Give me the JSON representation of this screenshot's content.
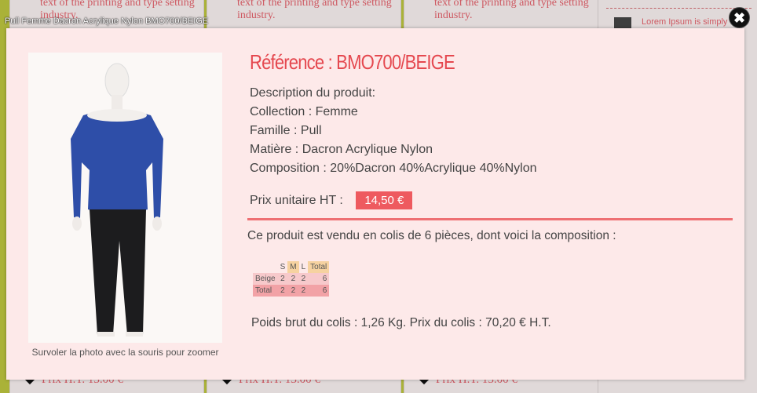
{
  "background": {
    "cards": [
      {
        "text": "text of the printing and type setting industry.",
        "price": "Prix H.T. 13.00 €"
      },
      {
        "text": "text of the printing and type setting industry.",
        "price": "Prix H.T. 13.00 €"
      },
      {
        "text": "text of the printing and type setting industry.",
        "price": "Prix H.T. 13.00 €"
      }
    ],
    "sidebar_text": "Lorem Ipsum is simply"
  },
  "lightbox": {
    "title": "Pull Femme Dacron Acrylique Nylon BMO700/BEIGE",
    "close_label": "✖",
    "photo_hint": "Survoler la photo avec la souris pour zoomer",
    "reference": "Référence : BMO700/BEIGE",
    "description": [
      "Description du produit:",
      "Collection : Femme",
      "Famille : Pull",
      "Matière : Dacron Acrylique Nylon",
      "Composition : 20%Dacron 40%Acrylique 40%Nylon"
    ],
    "price_label": "Prix unitaire HT :",
    "price_value": "14,50 €",
    "colis_text": "Ce produit est vendu en colis de 6 pièces, dont voici la composition :",
    "composition": {
      "headers": [
        "",
        "S",
        "M",
        "L",
        "Total"
      ],
      "rows": [
        [
          "Beige",
          "2",
          "2",
          "2",
          "6"
        ],
        [
          "Total",
          "2",
          "2",
          "2",
          "6"
        ]
      ]
    },
    "poids_text": "Poids brut du colis : 1,26 Kg. Prix du colis : 70,20 € H.T."
  },
  "colors": {
    "accent": "#e5484f",
    "badge": "#ee5a5f",
    "panel": "#fde9e9"
  }
}
